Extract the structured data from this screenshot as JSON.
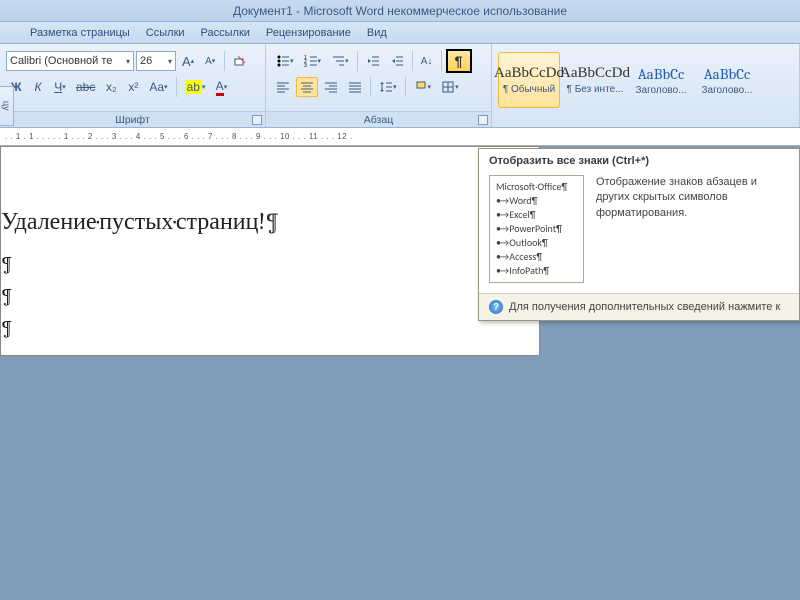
{
  "title": "Документ1 - Microsoft Word некоммерческое использование",
  "tabs": [
    "Разметка страницы",
    "Ссылки",
    "Рассылки",
    "Рецензирование",
    "Вид"
  ],
  "clip_label": "цу",
  "font": {
    "group_title": "Шрифт",
    "family": "Calibri (Основной те",
    "size": "26",
    "buttons": {
      "grow": "A",
      "shrink": "A",
      "clear": "Aa",
      "bold": "Ж",
      "italic": "К",
      "underline": "Ч",
      "strike": "abc",
      "sub": "x₂",
      "sup": "x²",
      "case": "Aa",
      "hilite": "ab",
      "color": "A"
    }
  },
  "paragraph": {
    "group_title": "Абзац",
    "pilcrow": "¶"
  },
  "styles": [
    {
      "preview": "AaBbCcDd",
      "label": "¶ Обычный",
      "sel": true,
      "blue": false
    },
    {
      "preview": "AaBbCcDd",
      "label": "¶ Без инте...",
      "sel": false,
      "blue": false
    },
    {
      "preview": "AaBbCc",
      "label": "Заголово...",
      "sel": false,
      "blue": true
    },
    {
      "preview": "AaBbCc",
      "label": "Заголово...",
      "sel": false,
      "blue": true
    }
  ],
  "ruler_marks": ". . 1 . 1 . . . . . 1 . . . 2 . . . 3 . . . 4 . . . 5 . . . 6 . . . 7 . . . 8 . . . 9 . . . 10 . . . 11 . . . 12 .",
  "document": {
    "heading": "Удаление·пустых·страниц!¶",
    "blank_mark": "¶"
  },
  "tooltip": {
    "title": "Отобразить все знаки (Ctrl+*)",
    "sample_head": "Microsoft·Office¶",
    "sample_items": [
      "Word¶",
      "Excel¶",
      "PowerPoint¶",
      "Outlook¶",
      "Access¶",
      "InfoPath¶"
    ],
    "desc": "Отображение знаков абзацев и другиx скрытых символов форматирования.",
    "footer": "Для получения дополнительных сведений нажмите к"
  }
}
